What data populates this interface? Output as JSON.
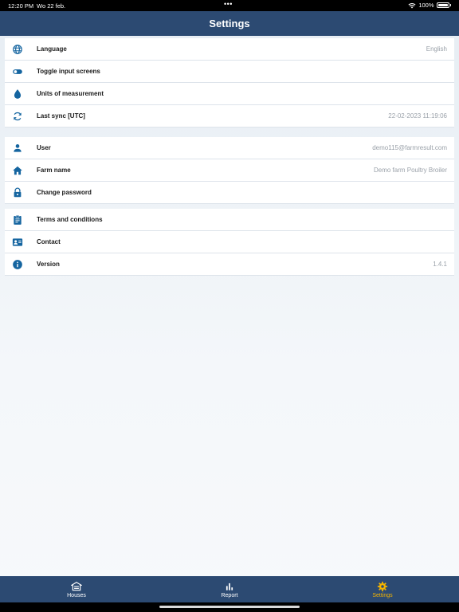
{
  "statusbar": {
    "time": "12:20 PM",
    "date": "Wo 22 feb.",
    "dots": "•••",
    "battery": "100%"
  },
  "header": {
    "title": "Settings"
  },
  "groups": [
    [
      {
        "label": "Language",
        "value": "English",
        "icon": "globe-icon"
      },
      {
        "label": "Toggle input screens",
        "value": "",
        "icon": "toggle-icon"
      },
      {
        "label": "Units of measurement",
        "value": "",
        "icon": "water-drop-icon"
      },
      {
        "label": "Last sync [UTC]",
        "value": "22-02-2023 11:19:06",
        "icon": "sync-icon"
      }
    ],
    [
      {
        "label": "User",
        "value": "demo115@farmresult.com",
        "icon": "person-icon"
      },
      {
        "label": "Farm name",
        "value": "Demo farm Poultry Broiler",
        "icon": "home-icon"
      },
      {
        "label": "Change password",
        "value": "",
        "icon": "lock-icon"
      }
    ],
    [
      {
        "label": "Terms and conditions",
        "value": "",
        "icon": "clipboard-icon"
      },
      {
        "label": "Contact",
        "value": "",
        "icon": "contact-card-icon"
      },
      {
        "label": "Version",
        "value": "1.4.1",
        "icon": "info-icon"
      }
    ]
  ],
  "tabs": [
    {
      "label": "Houses",
      "icon": "barn-icon",
      "active": false
    },
    {
      "label": "Report",
      "icon": "bar-chart-icon",
      "active": false
    },
    {
      "label": "Settings",
      "icon": "gear-icon",
      "active": true
    }
  ],
  "colors": {
    "header": "#2c4a72",
    "icon": "#1565a0",
    "active_tab": "#f4b400"
  }
}
